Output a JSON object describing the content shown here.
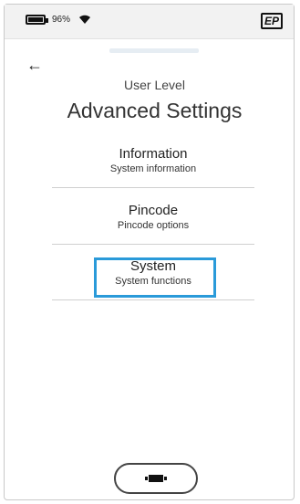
{
  "status_bar": {
    "battery_percent": "96%",
    "battery_icon": "battery-full-icon",
    "wifi_icon": "wifi-icon",
    "logo_text": "EP"
  },
  "nav": {
    "back_icon": "back-arrow-icon",
    "back_glyph": "←"
  },
  "header": {
    "subtitle": "User Level",
    "title": "Advanced Settings"
  },
  "menu": {
    "items": [
      {
        "label": "Information",
        "description": "System information"
      },
      {
        "label": "Pincode",
        "description": "Pincode options"
      },
      {
        "label": "System",
        "description": "System functions",
        "selected": true
      }
    ]
  },
  "footer": {
    "home_icon": "home-button-icon"
  },
  "colors": {
    "selection": "#2a9ad9",
    "status_bar_bg": "#f2f2f2"
  }
}
